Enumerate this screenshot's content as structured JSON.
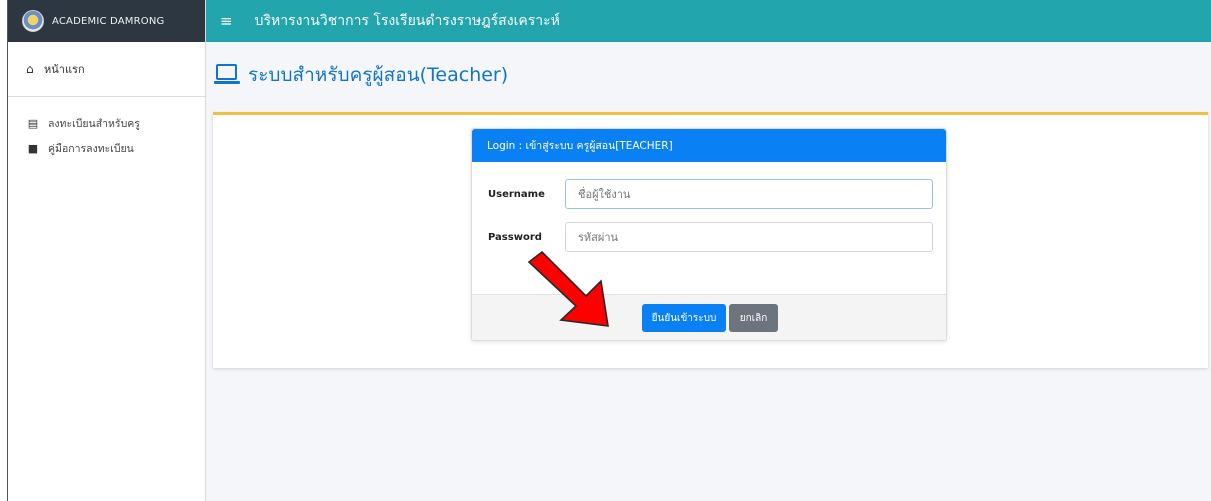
{
  "brand": {
    "name": "ACADEMIC DAMRONG"
  },
  "sidebar": {
    "home_label": "หน้าแรก",
    "items": [
      {
        "label": "ลงทะเบียนสำหรับครู",
        "icon": "register-icon"
      },
      {
        "label": "คู่มือการลงทะเบียน",
        "icon": "manual-icon"
      }
    ]
  },
  "topbar": {
    "title": "บริหารงานวิชาการ  โรงเรียนดำรงราษฎร์สงเคราะห์"
  },
  "page": {
    "title": "ระบบสำหรับครูผู้สอน(Teacher)"
  },
  "login": {
    "header": "Login : เข้าสู่ระบบ ครูผู้สอน[TEACHER]",
    "username_label": "Username",
    "username_placeholder": "ชื่อผู้ใช้งาน",
    "password_label": "Password",
    "password_placeholder": "รหัสผ่าน",
    "submit_label": "ยืนยันเข้าระบบ",
    "cancel_label": "ยกเลิก"
  },
  "colors": {
    "topbar": "#23a5ad",
    "brand_bg": "#2c3742",
    "primary": "#0a80f5",
    "card_accent": "#f0c040",
    "annotation_arrow": "#ff0000"
  }
}
